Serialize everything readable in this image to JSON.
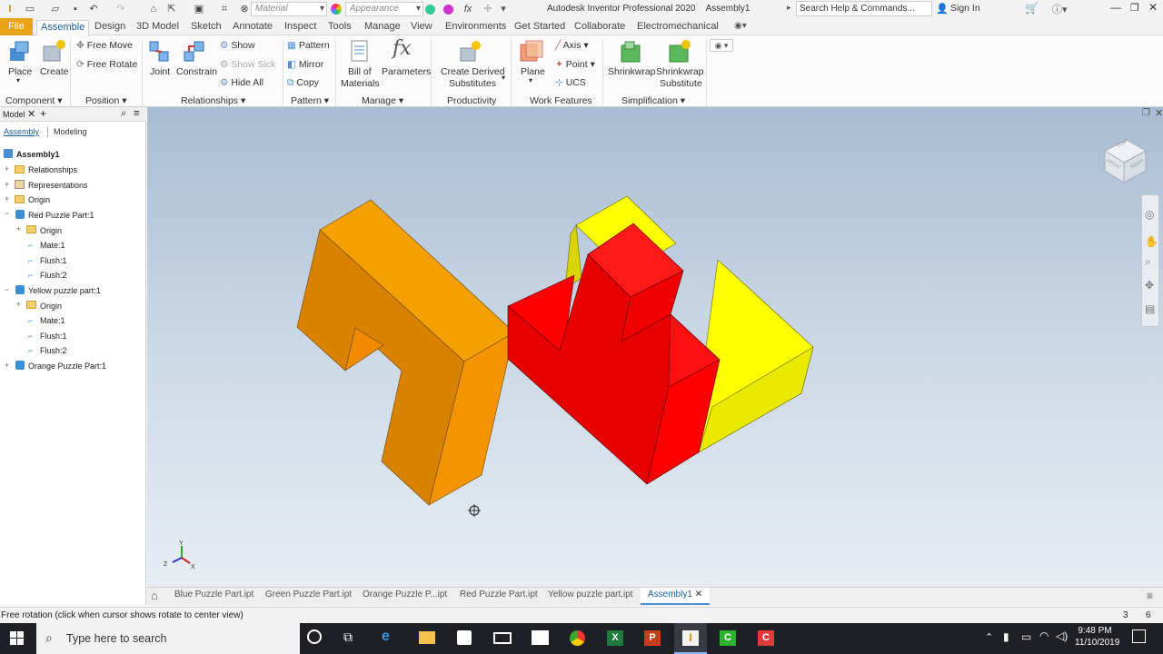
{
  "app": {
    "title": "Autodesk Inventor Professional 2020",
    "document": "Assembly1"
  },
  "quick_access": {
    "material_placeholder": "Material",
    "appearance_placeholder": "Appearance",
    "search_placeholder": "Search Help & Commands...",
    "sign_in": "Sign In"
  },
  "tabs": [
    "File",
    "Assemble",
    "Design",
    "3D Model",
    "Sketch",
    "Annotate",
    "Inspect",
    "Tools",
    "Manage",
    "View",
    "Environments",
    "Get Started",
    "Collaborate",
    "Electromechanical"
  ],
  "ribbon": {
    "place": "Place",
    "create": "Create",
    "free_move": "Free Move",
    "free_rotate": "Free Rotate",
    "joint": "Joint",
    "constrain": "Constrain",
    "show": "Show",
    "show_sick": "Show Sick",
    "hide_all": "Hide All",
    "pattern": "Pattern",
    "mirror": "Mirror",
    "copy": "Copy",
    "bom_line1": "Bill of",
    "bom_line2": "Materials",
    "parameters": "Parameters",
    "cds_line1": "Create Derived",
    "cds_line2": "Substitutes",
    "plane": "Plane",
    "axis": "Axis",
    "point": "Point",
    "ucs": "UCS",
    "shrinkwrap": "Shrinkwrap",
    "sws_line1": "Shrinkwrap",
    "sws_line2": "Substitute",
    "groups": {
      "component": "Component",
      "position": "Position",
      "relationships": "Relationships",
      "pattern": "Pattern",
      "manage": "Manage",
      "productivity": "Productivity",
      "work_features": "Work Features",
      "simplification": "Simplification"
    }
  },
  "browser": {
    "title": "Model",
    "tab_assembly": "Assembly",
    "tab_modeling": "Modeling",
    "items": [
      "Assembly1",
      "Relationships",
      "Representations",
      "Origin",
      "Red Puzzle Part:1",
      "Origin",
      "Mate:1",
      "Flush:1",
      "Flush:2",
      "Yellow puzzle part:1",
      "Origin",
      "Mate:1",
      "Flush:1",
      "Flush:2",
      "Orange Puzzle Part:1"
    ]
  },
  "doc_tabs": [
    "Blue Puzzle Part.ipt",
    "Green Puzzle Part.ipt",
    "Orange Puzzle P...ipt",
    "Red Puzzle Part.ipt",
    "Yellow puzzle part.ipt",
    "Assembly1"
  ],
  "status": {
    "message": "Free rotation (click when cursor shows rotate to center view)",
    "num1": "3",
    "num2": "6"
  },
  "taskbar": {
    "search": "Type here to search",
    "time": "9:48 PM",
    "date": "11/10/2019"
  },
  "viewcube": {
    "top": "TOP",
    "front": "FRONT",
    "right": "RIGHT"
  },
  "colors": {
    "orange": "#f5a000",
    "red": "#ff0000",
    "yellow": "#ffff00",
    "file_tab": "#e8a317",
    "accent": "#1a5c9e"
  }
}
